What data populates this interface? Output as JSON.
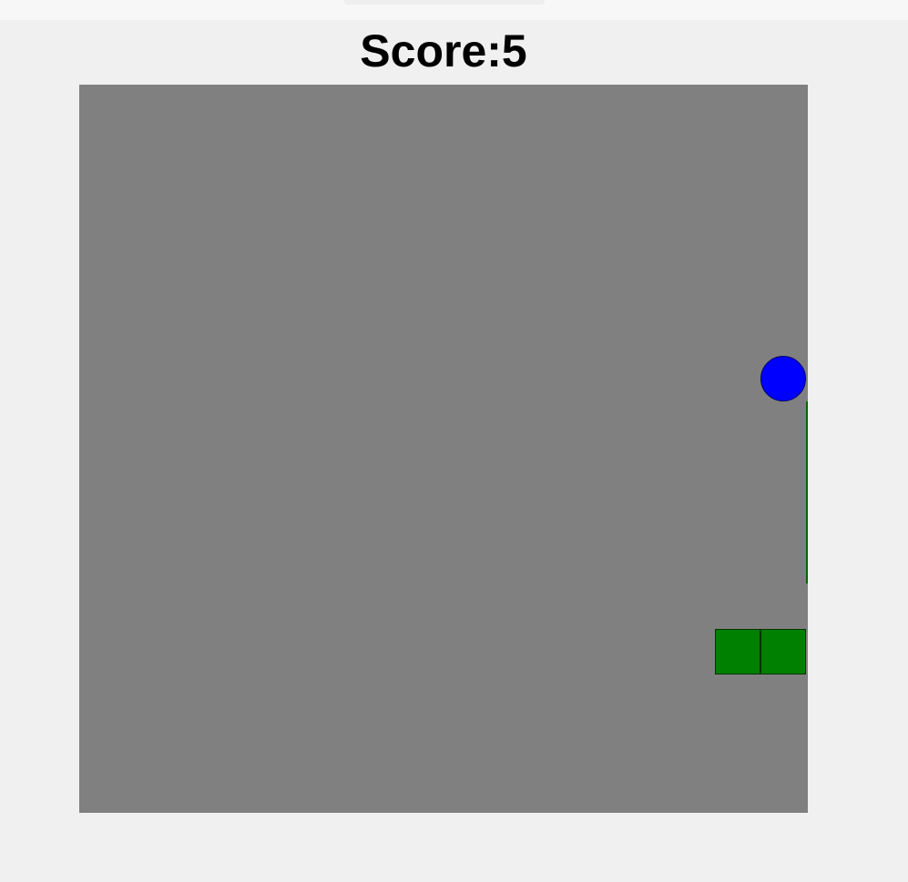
{
  "window": {
    "title": ""
  },
  "header": {
    "score_label": "Score:5"
  },
  "game": {
    "score": 5,
    "colors": {
      "background": "#f0f0f0",
      "board": "#808080",
      "snake": "#008000",
      "food": "#0000ff"
    },
    "food": {
      "shape": "circle",
      "color": "#0000ff"
    },
    "snake": {
      "color": "#008000",
      "segment_count": 6
    }
  }
}
